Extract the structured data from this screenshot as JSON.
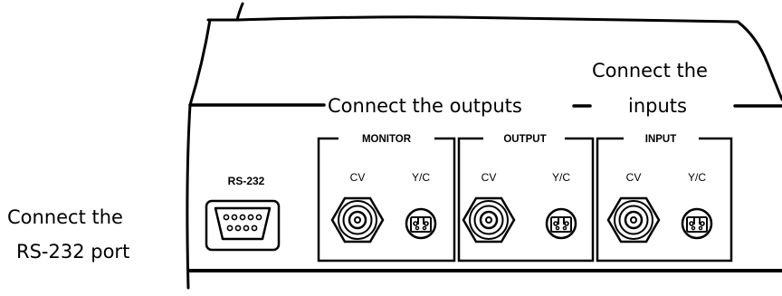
{
  "annotations": {
    "outputs": "Connect the outputs",
    "inputs_line1": "Connect the",
    "inputs_line2": "inputs",
    "rs232_line1": "Connect the",
    "rs232_line2": "RS-232 port"
  },
  "rear_panel": {
    "rs232_label": "RS-232",
    "groups": [
      {
        "title": "MONITOR",
        "ports": [
          "CV",
          "Y/C"
        ]
      },
      {
        "title": "OUTPUT",
        "ports": [
          "CV",
          "Y/C"
        ]
      },
      {
        "title": "INPUT",
        "ports": [
          "CV",
          "Y/C"
        ]
      }
    ]
  }
}
